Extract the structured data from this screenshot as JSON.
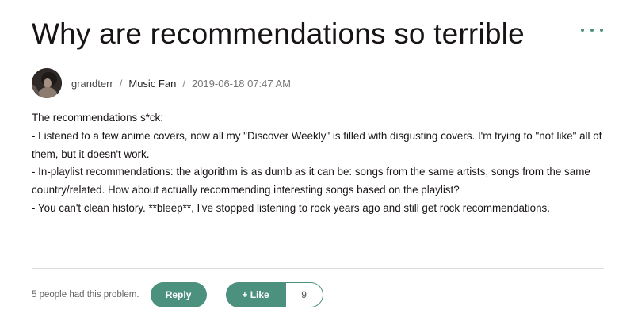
{
  "post": {
    "title": "Why are recommendations so terrible",
    "author": "grandterr",
    "separator": "/",
    "board": "Music Fan",
    "date": "2019-06-18 07:47 AM",
    "body_lines": [
      "The recommendations s*ck:",
      "- Listened to a few anime covers, now all my \"Discover Weekly\" is filled with disgusting covers. I'm trying to \"not like\" all of them, but it doesn't work.",
      "- In-playlist recommendations: the algorithm is as dumb as it can be: songs from the same artists, songs from the same country/related. How about actually recommending interesting songs based on the playlist?",
      "- You can't clean history. **bleep**, I've stopped listening to rock years ago and still get rock recommendations."
    ]
  },
  "footer": {
    "problem_text": "5 people had this problem.",
    "reply_label": "Reply",
    "like_label": "+ Like",
    "like_count": "9"
  },
  "icons": {
    "more": "more-horizontal-icon",
    "avatar": "user-avatar"
  },
  "colors": {
    "accent": "#4b917d",
    "text": "#191414",
    "muted": "#666666",
    "divider": "#dcdcdc"
  }
}
